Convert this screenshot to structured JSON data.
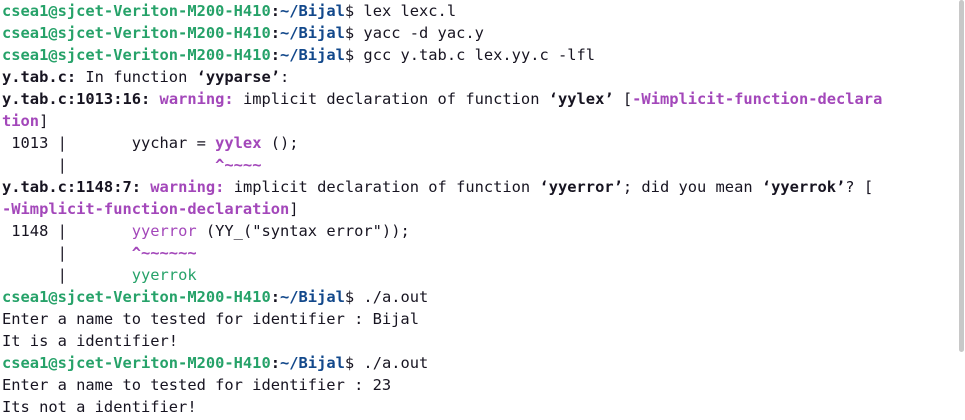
{
  "prompt": {
    "user_host": "csea1@sjcet-Veriton-M200-H410",
    "sep": ":",
    "path": "~/Bijal",
    "sigil": "$"
  },
  "lines": {
    "l1": {
      "cmd": " lex lexc.l"
    },
    "l2": {
      "cmd": " yacc -d yac.y"
    },
    "l3": {
      "cmd": " gcc y.tab.c lex.yy.c -lfl"
    },
    "l4": {
      "file": "y.tab.c:",
      "text": " In function ",
      "func": "‘yyparse’",
      "end": ":"
    },
    "l5": {
      "loc": "y.tab.c:1013:16:",
      "sp": " ",
      "warn": "warning:",
      "text": " implicit declaration of function ",
      "func": "‘yylex’",
      "sp2": " [",
      "flag": "-Wimplicit-function-declara"
    },
    "l6": {
      "flag": "tion",
      "end": "]"
    },
    "l7": {
      "pre": " 1013 |       yychar = ",
      "hl": "yylex",
      "post": " ();"
    },
    "l8": {
      "pre": "      |                ",
      "caret": "^~~~~"
    },
    "l9": {
      "loc": "y.tab.c:1148:7:",
      "sp": " ",
      "warn": "warning:",
      "text": " implicit declaration of function ",
      "func": "‘yyerror’",
      "mid": "; did you mean ",
      "sug": "‘yyerrok’",
      "end": "? ["
    },
    "l10": {
      "flag": "-Wimplicit-function-declaration",
      "end": "]"
    },
    "l11": {
      "pre": " 1148 |       ",
      "hl": "yyerror",
      "post": " (YY_(\"syntax error\"));"
    },
    "l12": {
      "pre": "      |       ",
      "caret": "^~~~~~~"
    },
    "l13": {
      "pre": "      |       ",
      "fix": "yyerrok"
    },
    "l14": {
      "cmd": " ./a.out"
    },
    "l15": {
      "text": "Enter a name to tested for identifier : Bijal"
    },
    "l16": {
      "text": "It is a identifier!"
    },
    "l17": {
      "cmd": " ./a.out"
    },
    "l18": {
      "text": "Enter a name to tested for identifier : 23"
    },
    "l19": {
      "text": "Its not a identifier!"
    }
  },
  "colors": {
    "prompt": "#26a269",
    "path": "#12488b",
    "warning": "#a347ba",
    "text": "#171421",
    "background": "#ffffff"
  }
}
